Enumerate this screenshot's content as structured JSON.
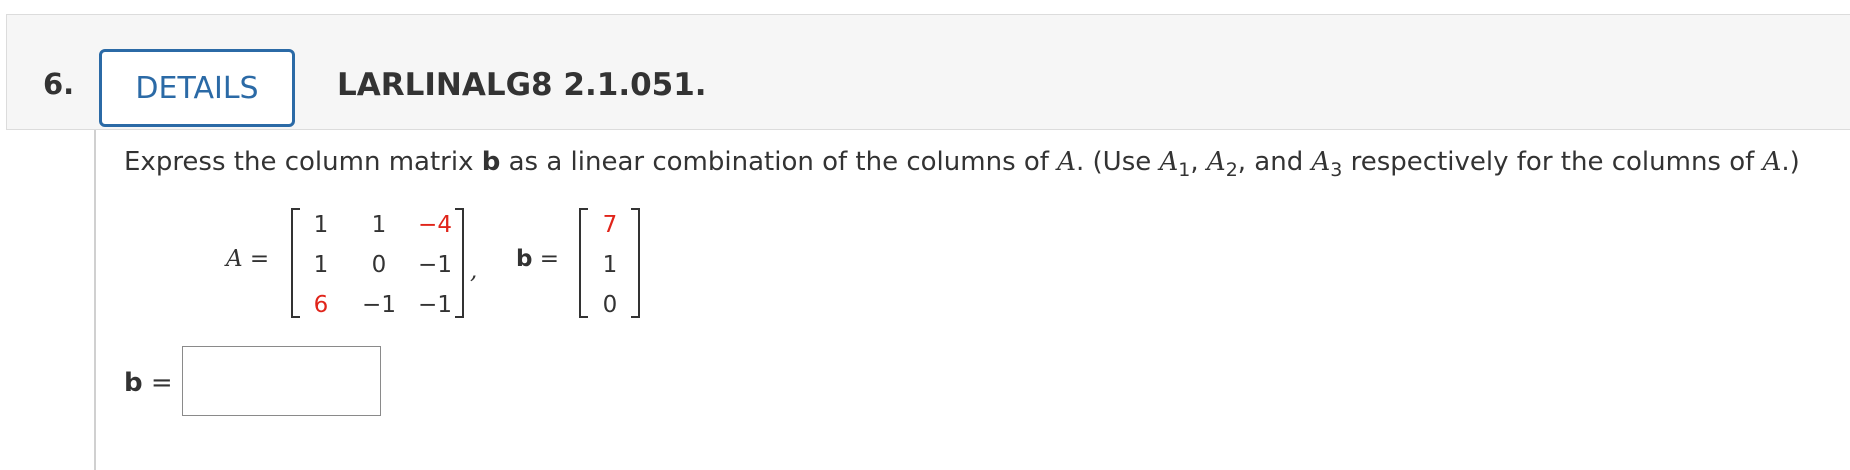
{
  "question": {
    "number": "6.",
    "details_label": "DETAILS",
    "code": "LARLINALG8 2.1.051."
  },
  "prompt": {
    "part1": "Express the column matrix ",
    "bold_b": "b",
    "part2": " as a linear combination of the columns of ",
    "A": "A",
    "part3": ". (Use ",
    "A1_base": "A",
    "A1_sub": "1",
    "sep1": ", ",
    "A2_base": "A",
    "A2_sub": "2",
    "sep2": ", and ",
    "A3_base": "A",
    "A3_sub": "3",
    "part4": " respectively for the columns of ",
    "A_end": "A",
    "part5": ".)"
  },
  "matrices": {
    "A_label": "A",
    "equals": " =",
    "comma": ",",
    "b_label": "b",
    "A": [
      [
        "1",
        "1",
        "−4"
      ],
      [
        "1",
        "0",
        "−1"
      ],
      [
        "6",
        "−1",
        "−1"
      ]
    ],
    "b": [
      "7",
      "1",
      "0"
    ]
  },
  "answer": {
    "label": "b",
    "equals": " =",
    "value": ""
  },
  "colors": {
    "accent": "#2b6aa6",
    "highlight": "#e0241a",
    "header_bg": "#f6f6f6"
  }
}
